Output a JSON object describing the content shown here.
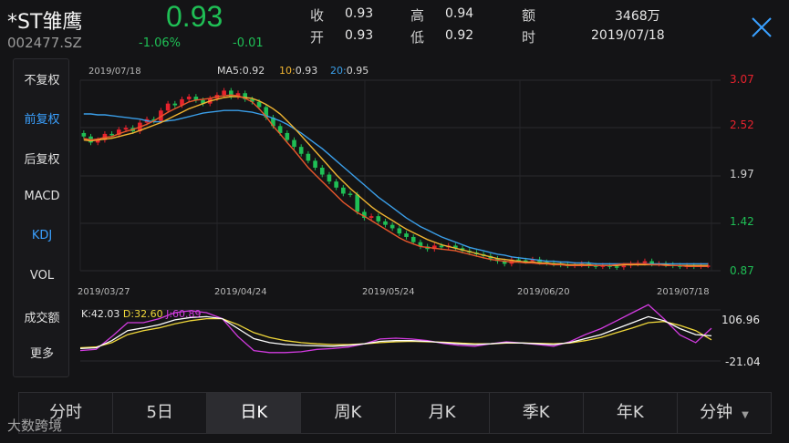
{
  "stock": {
    "name": "*ST雏鹰",
    "code": "002477.SZ",
    "price": "0.93",
    "change_pct": "-1.06%",
    "change": "-0.01"
  },
  "quote": {
    "close_label": "收",
    "close": "0.93",
    "open_label": "开",
    "open": "0.93",
    "high_label": "高",
    "high": "0.94",
    "low_label": "低",
    "low": "0.92",
    "amount_label": "额",
    "amount": "3468万",
    "time_label": "时",
    "time": "2019/07/18"
  },
  "menu": [
    {
      "label": "不复权",
      "active": false
    },
    {
      "label": "前复权",
      "active": true
    },
    {
      "label": "后复权",
      "active": false
    },
    {
      "label": "MACD",
      "active": false
    },
    {
      "label": "KDJ",
      "active": true
    },
    {
      "label": "VOL",
      "active": false
    },
    {
      "label": "成交额",
      "active": false
    },
    {
      "label": "更多",
      "active": false
    }
  ],
  "ma_legend": {
    "date": "2019/07/18",
    "ma5_label": "MA5:",
    "ma5": "0.92",
    "ma10_label": "10:",
    "ma10": "0.93",
    "ma20_label": "20:",
    "ma20": "0.95"
  },
  "price_axis": [
    "3.07",
    "2.52",
    "1.97",
    "1.42",
    "0.87"
  ],
  "date_axis": [
    "2019/03/27",
    "2019/04/24",
    "2019/05/24",
    "2019/06/20",
    "2019/07/18"
  ],
  "kdj_legend": {
    "k": "K:42.03",
    "d": "D:32.60",
    "j": "J:60.89"
  },
  "kdj_axis": [
    "106.96",
    "-21.04"
  ],
  "tabs": [
    {
      "label": "分时",
      "active": false
    },
    {
      "label": "5日",
      "active": false
    },
    {
      "label": "日K",
      "active": true
    },
    {
      "label": "周K",
      "active": false
    },
    {
      "label": "月K",
      "active": false
    },
    {
      "label": "季K",
      "active": false
    },
    {
      "label": "年K",
      "active": false
    },
    {
      "label": "分钟",
      "active": false
    }
  ],
  "watermark": "大数跨境",
  "colors": {
    "up": "#e8222d",
    "down": "#1fbf55",
    "ma5": "#e8572b",
    "ma10": "#f0b431",
    "ma20": "#3a9ee8",
    "k": "#ffffff",
    "d": "#f0d83a",
    "j": "#d23be0"
  },
  "chart_data": {
    "type": "candlestick",
    "ylim": [
      0.87,
      3.07
    ],
    "close": [
      2.42,
      2.35,
      2.38,
      2.45,
      2.44,
      2.5,
      2.52,
      2.48,
      2.58,
      2.62,
      2.6,
      2.72,
      2.8,
      2.78,
      2.85,
      2.88,
      2.84,
      2.8,
      2.86,
      2.9,
      2.95,
      2.88,
      2.92,
      2.85,
      2.82,
      2.76,
      2.64,
      2.54,
      2.46,
      2.38,
      2.3,
      2.22,
      2.14,
      2.06,
      1.98,
      1.9,
      1.83,
      1.76,
      1.75,
      1.55,
      1.48,
      1.5,
      1.44,
      1.4,
      1.36,
      1.3,
      1.26,
      1.2,
      1.15,
      1.12,
      1.16,
      1.14,
      1.16,
      1.13,
      1.1,
      1.08,
      1.06,
      1.04,
      1.01,
      0.98,
      0.95,
      1.0,
      0.99,
      0.98,
      1.0,
      0.97,
      0.96,
      0.95,
      0.94,
      0.93,
      0.94,
      0.95,
      0.93,
      0.92,
      0.93,
      0.92,
      0.91,
      0.93,
      0.95,
      0.96,
      0.98,
      0.95,
      0.95,
      0.94,
      0.93,
      0.92,
      0.93,
      0.92,
      0.93,
      0.93
    ],
    "ma5": [
      2.4,
      2.38,
      2.39,
      2.41,
      2.42,
      2.45,
      2.48,
      2.5,
      2.53,
      2.56,
      2.6,
      2.65,
      2.7,
      2.74,
      2.78,
      2.82,
      2.84,
      2.85,
      2.86,
      2.88,
      2.89,
      2.9,
      2.89,
      2.86,
      2.82,
      2.74,
      2.65,
      2.54,
      2.45,
      2.35,
      2.26,
      2.16,
      2.06,
      1.98,
      1.9,
      1.82,
      1.74,
      1.66,
      1.6,
      1.54,
      1.5,
      1.45,
      1.4,
      1.35,
      1.3,
      1.25,
      1.21,
      1.18,
      1.15,
      1.14,
      1.13,
      1.12,
      1.11,
      1.1,
      1.08,
      1.06,
      1.04,
      1.02,
      1.0,
      0.99,
      0.98,
      0.97,
      0.97,
      0.96,
      0.96,
      0.95,
      0.95,
      0.94,
      0.94,
      0.93,
      0.93,
      0.93,
      0.93,
      0.93,
      0.93,
      0.93,
      0.94,
      0.95,
      0.95,
      0.95,
      0.95,
      0.94,
      0.94,
      0.93,
      0.93,
      0.93,
      0.92,
      0.92,
      0.92,
      0.92
    ],
    "ma10": [
      2.38,
      2.37,
      2.38,
      2.39,
      2.4,
      2.42,
      2.44,
      2.46,
      2.49,
      2.52,
      2.55,
      2.58,
      2.62,
      2.66,
      2.7,
      2.74,
      2.77,
      2.8,
      2.83,
      2.85,
      2.87,
      2.88,
      2.88,
      2.87,
      2.86,
      2.83,
      2.79,
      2.74,
      2.68,
      2.6,
      2.52,
      2.43,
      2.34,
      2.25,
      2.16,
      2.07,
      1.98,
      1.9,
      1.82,
      1.75,
      1.68,
      1.61,
      1.55,
      1.5,
      1.45,
      1.4,
      1.35,
      1.31,
      1.27,
      1.23,
      1.2,
      1.17,
      1.15,
      1.13,
      1.11,
      1.09,
      1.07,
      1.05,
      1.03,
      1.01,
      1.0,
      0.99,
      0.98,
      0.97,
      0.97,
      0.96,
      0.96,
      0.95,
      0.95,
      0.94,
      0.94,
      0.94,
      0.94,
      0.93,
      0.93,
      0.93,
      0.93,
      0.94,
      0.94,
      0.94,
      0.94,
      0.94,
      0.94,
      0.94,
      0.93,
      0.93,
      0.93,
      0.93,
      0.93,
      0.93
    ],
    "ma20": [
      2.68,
      2.68,
      2.67,
      2.67,
      2.66,
      2.65,
      2.64,
      2.63,
      2.62,
      2.6,
      2.59,
      2.59,
      2.6,
      2.61,
      2.63,
      2.65,
      2.67,
      2.69,
      2.7,
      2.71,
      2.72,
      2.72,
      2.72,
      2.71,
      2.7,
      2.68,
      2.66,
      2.63,
      2.6,
      2.56,
      2.51,
      2.46,
      2.4,
      2.34,
      2.28,
      2.21,
      2.14,
      2.07,
      2.0,
      1.93,
      1.86,
      1.79,
      1.72,
      1.66,
      1.6,
      1.54,
      1.48,
      1.43,
      1.38,
      1.34,
      1.3,
      1.26,
      1.23,
      1.2,
      1.17,
      1.14,
      1.12,
      1.1,
      1.08,
      1.06,
      1.05,
      1.03,
      1.02,
      1.01,
      1.0,
      0.99,
      0.98,
      0.98,
      0.97,
      0.97,
      0.96,
      0.96,
      0.96,
      0.95,
      0.95,
      0.95,
      0.95,
      0.95,
      0.95,
      0.95,
      0.95,
      0.95,
      0.95,
      0.95,
      0.95,
      0.95,
      0.95,
      0.95,
      0.95,
      0.95
    ],
    "kdj_ylim": [
      -21.04,
      106.96
    ],
    "k": [
      10,
      12,
      30,
      55,
      62,
      70,
      82,
      88,
      90,
      85,
      60,
      35,
      25,
      20,
      18,
      17,
      16,
      18,
      22,
      28,
      30,
      30,
      28,
      25,
      22,
      20,
      22,
      25,
      24,
      22,
      20,
      25,
      35,
      45,
      60,
      75,
      90,
      80,
      60,
      45,
      42
    ],
    "d": [
      12,
      14,
      25,
      45,
      55,
      62,
      72,
      80,
      85,
      85,
      70,
      50,
      38,
      30,
      25,
      22,
      20,
      20,
      22,
      25,
      27,
      28,
      27,
      26,
      24,
      22,
      22,
      24,
      24,
      23,
      22,
      24,
      30,
      38,
      50,
      62,
      75,
      78,
      68,
      55,
      32
    ],
    "j": [
      5,
      8,
      40,
      75,
      75,
      85,
      100,
      105,
      100,
      85,
      40,
      5,
      0,
      0,
      2,
      8,
      10,
      14,
      22,
      34,
      36,
      34,
      30,
      23,
      18,
      16,
      22,
      27,
      24,
      20,
      16,
      27,
      45,
      60,
      80,
      100,
      120,
      84,
      44,
      25,
      61
    ]
  }
}
